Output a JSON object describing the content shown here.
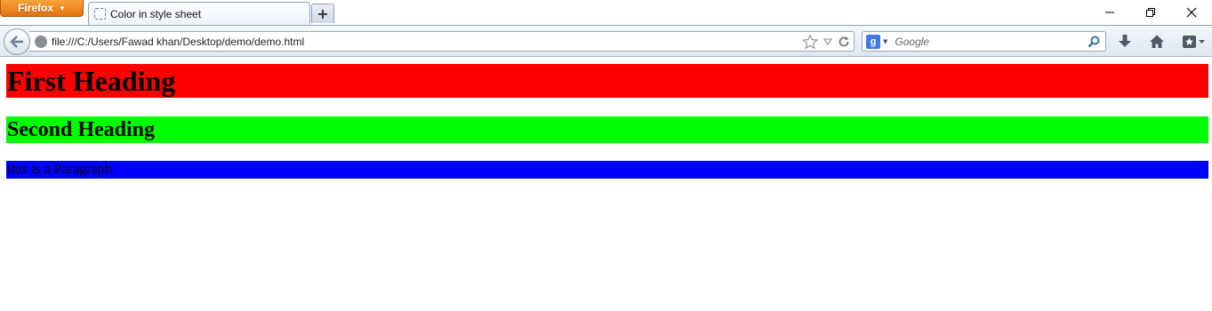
{
  "browser": {
    "menu_button_label": "Firefox",
    "tab_title": "Color in style sheet",
    "new_tab_label": "+",
    "url": "file:///C:/Users/Fawad khan/Desktop/demo/demo.html",
    "search_placeholder": "Google",
    "search_engine_letter": "g"
  },
  "page": {
    "heading1": "First Heading",
    "heading2": "Second Heading",
    "paragraph": "this is a Paragraph"
  },
  "colors": {
    "heading1_bg": "#ff0000",
    "heading2_bg": "#00ff00",
    "paragraph_bg": "#0000ff",
    "firefox_button": "#e3720f"
  },
  "icons": [
    "page-icon",
    "globe-icon",
    "back-arrow-icon",
    "star-icon",
    "dropdown-triangle-icon",
    "reload-icon",
    "google-icon",
    "search-icon",
    "download-icon",
    "home-icon",
    "bookmarks-icon",
    "minimize-icon",
    "restore-icon",
    "close-icon"
  ]
}
